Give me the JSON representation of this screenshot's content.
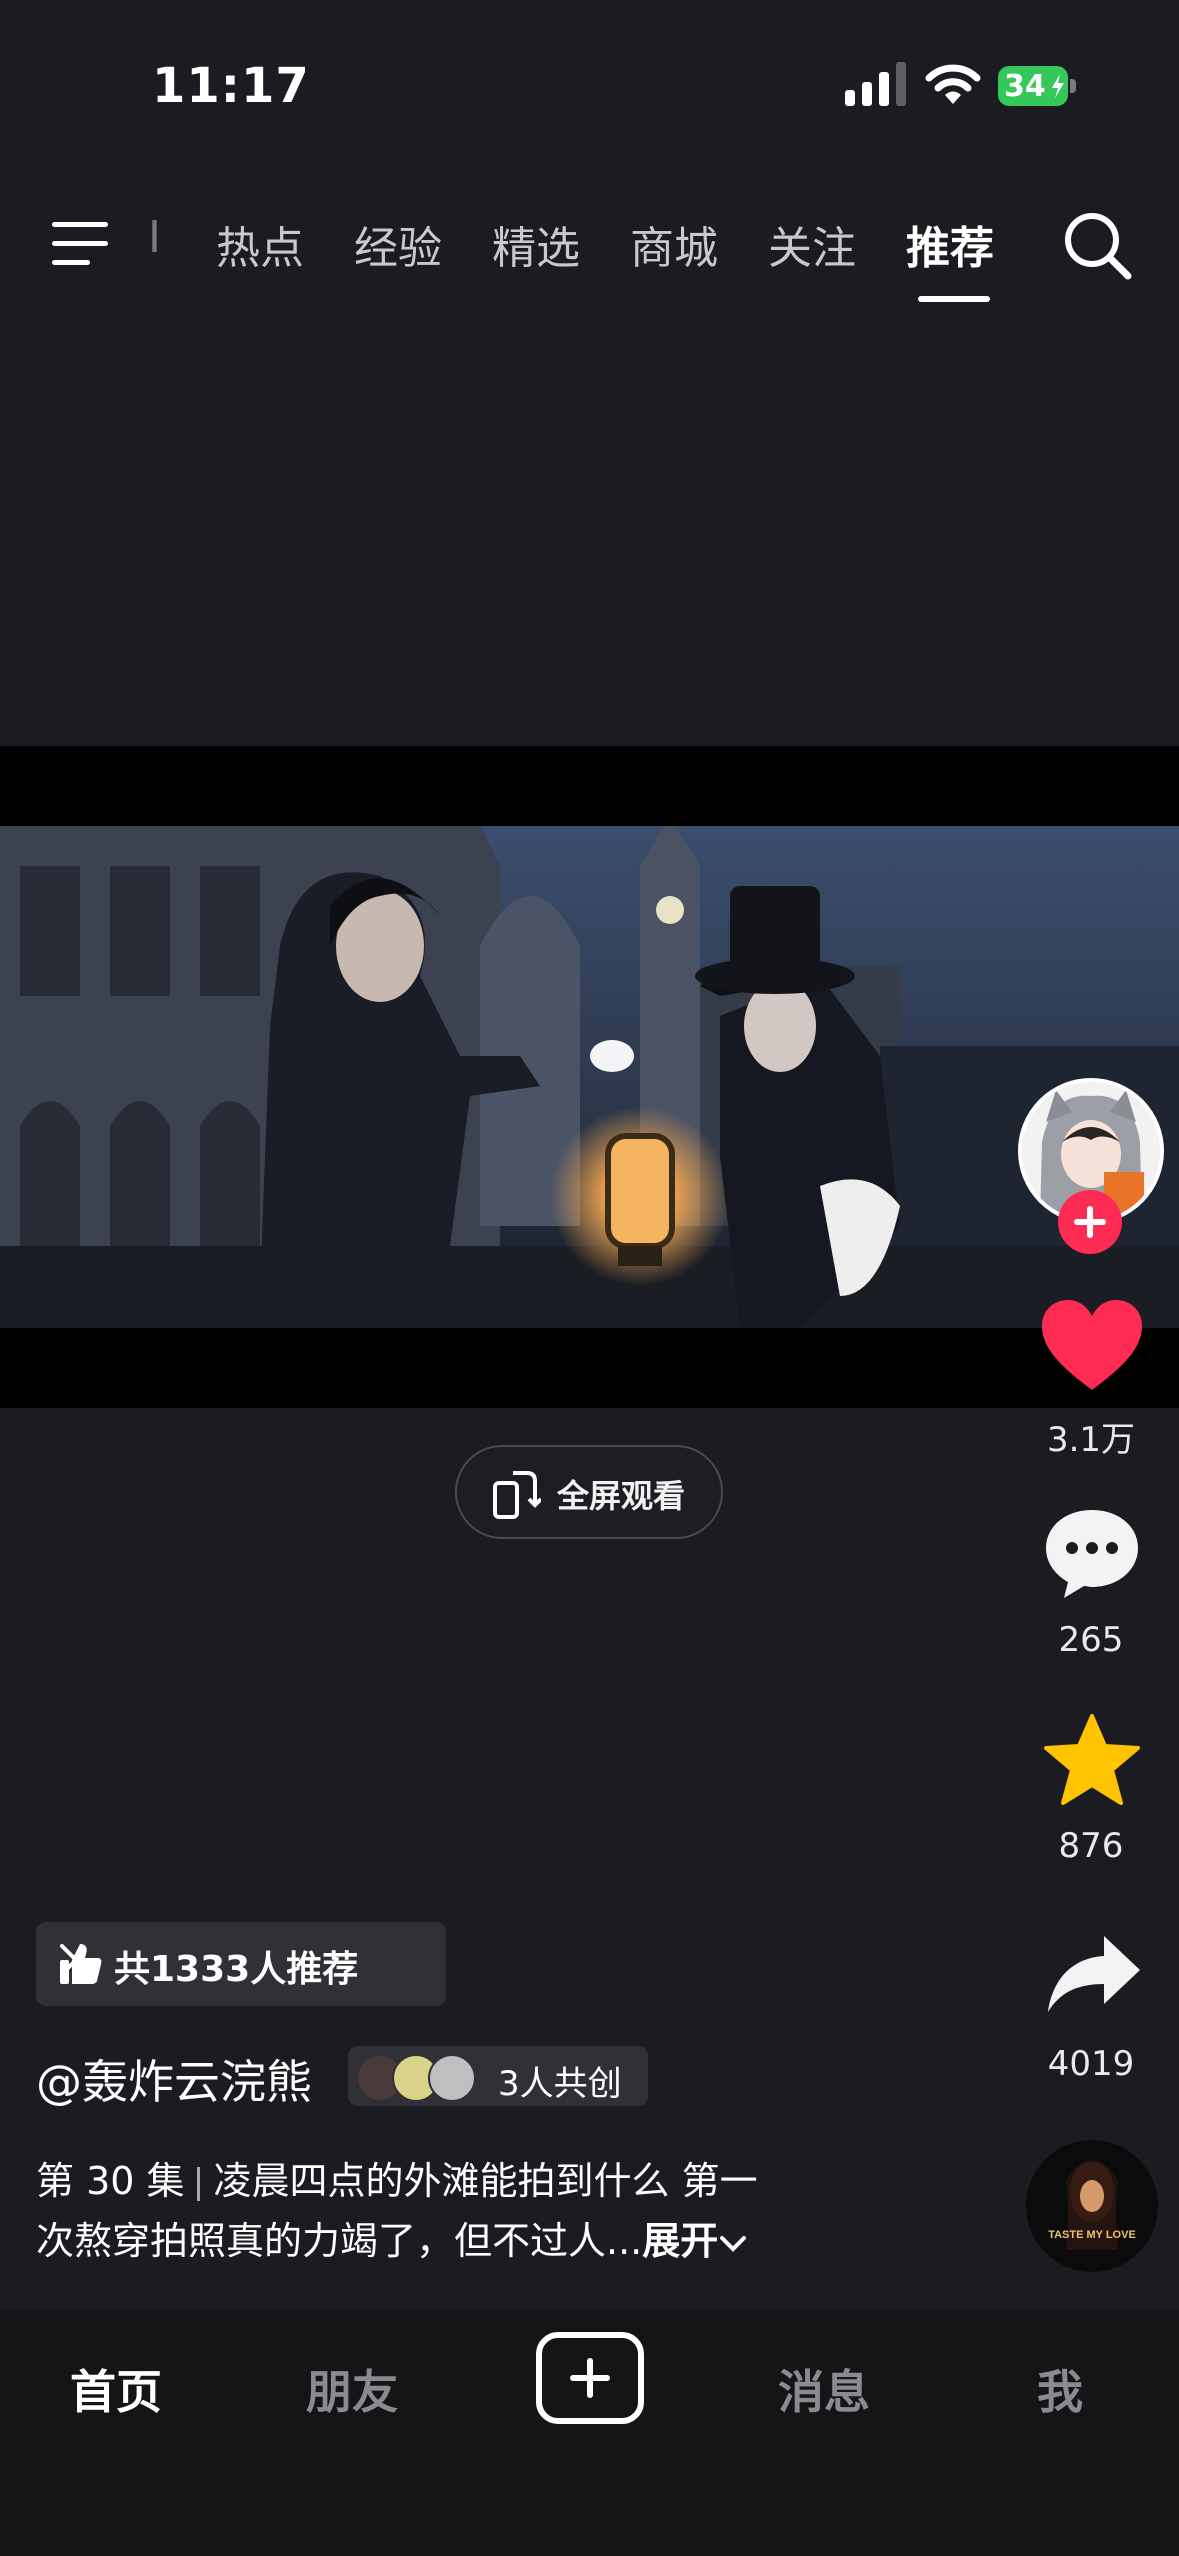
{
  "status_bar": {
    "time": "11:17",
    "battery": "34"
  },
  "top_nav": {
    "partial_tab": "I",
    "tabs": [
      {
        "label": "热点"
      },
      {
        "label": "经验"
      },
      {
        "label": "精选"
      },
      {
        "label": "商城"
      },
      {
        "label": "关注"
      },
      {
        "label": "推荐"
      }
    ],
    "active_tab": "推荐"
  },
  "video": {
    "fullscreen_label": "全屏观看"
  },
  "actions": {
    "likes": "3.1万",
    "comments": "265",
    "favorites": "876",
    "shares": "4019"
  },
  "music_disc": {
    "text": "TASTE MY LOVE"
  },
  "post": {
    "recommend_label": "共1333人推荐",
    "author": "@轰炸云浣熊",
    "co_create": "3人共创",
    "episode": "第 30 集",
    "description_line1": "凌晨四点的外滩能拍到什么 第一",
    "description_line2": "次熬穿拍照真的力竭了，但不过人...",
    "expand_label": "展开"
  },
  "bottom_tabs": {
    "home": "首页",
    "friends": "朋友",
    "messages": "消息",
    "me": "我"
  },
  "colors": {
    "background": "#1b1c21",
    "like_red": "#fe2c55",
    "favorite_yellow": "#ffc300",
    "battery_green": "#34c759"
  }
}
